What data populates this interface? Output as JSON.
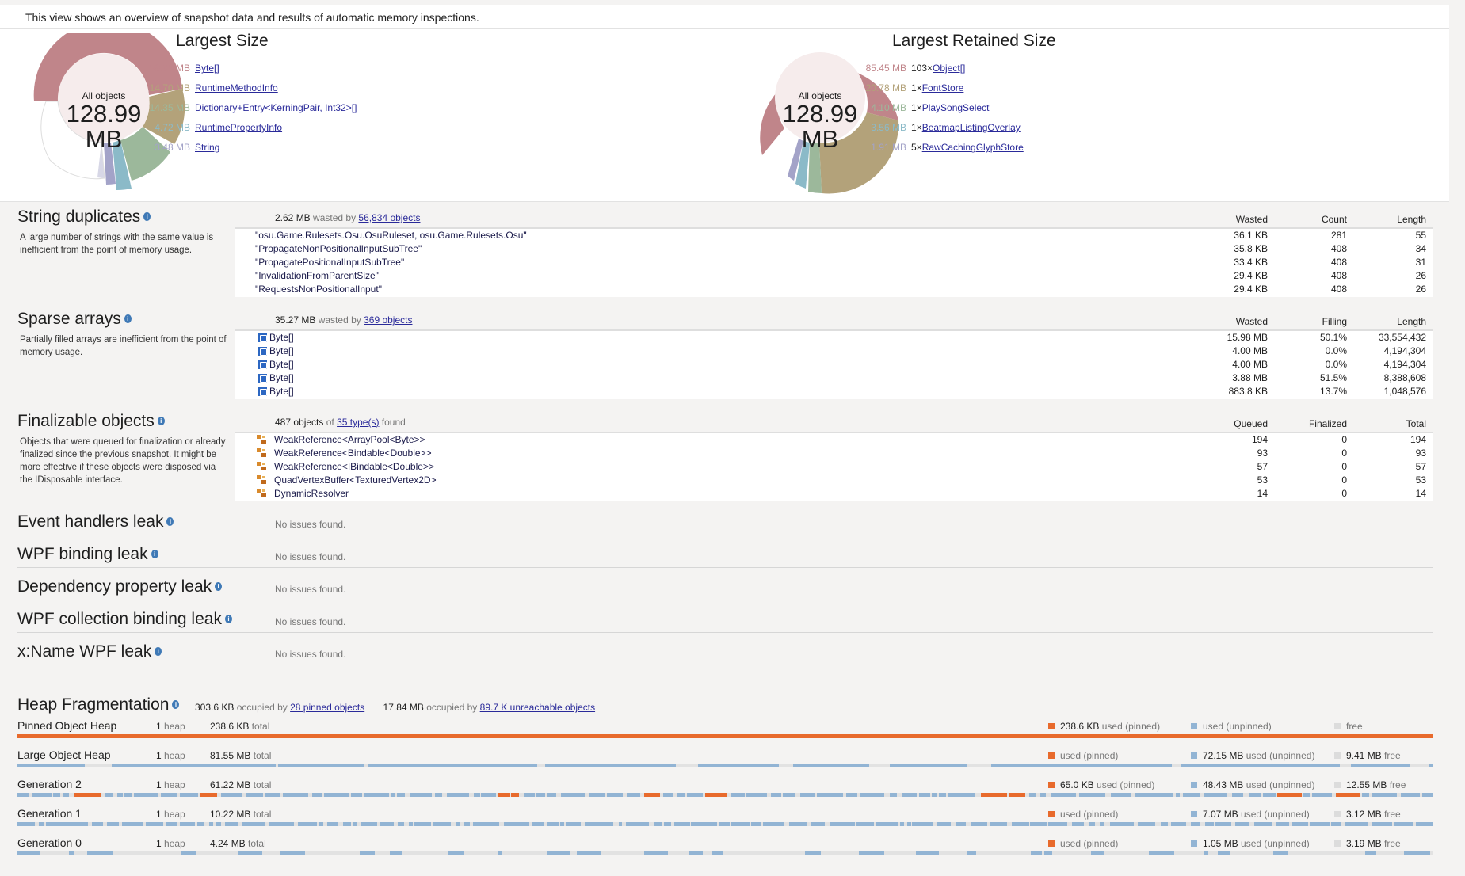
{
  "intro": "This view shows an overview of snapshot data and results of automatic memory inspections.",
  "largest_size": {
    "title": "Largest Size",
    "pie_label": "All objects",
    "pie_total": "128.99 MB",
    "items": [
      {
        "value": "58.69 MB",
        "prefix": "",
        "name": "Byte[]",
        "color": "#c0858a"
      },
      {
        "value": "14.70 MB",
        "prefix": "",
        "name": "RuntimeMethodInfo",
        "color": "#b3a27a"
      },
      {
        "value": "14.35 MB",
        "prefix": "",
        "name": "Dictionary+Entry<KerningPair, Int32>[]",
        "color": "#9cb89b"
      },
      {
        "value": "4.72 MB",
        "prefix": "",
        "name": "RuntimePropertyInfo",
        "color": "#8bbac8"
      },
      {
        "value": "3.48 MB",
        "prefix": "",
        "name": "String",
        "color": "#a3a3c8"
      }
    ]
  },
  "largest_retained": {
    "title": "Largest Retained Size",
    "pie_label": "All objects",
    "pie_total": "128.99 MB",
    "items": [
      {
        "value": "85.45 MB",
        "prefix": "103×",
        "name": "Object[]",
        "color": "#c0858a"
      },
      {
        "value": "20.78 MB",
        "prefix": "1×",
        "name": "FontStore",
        "color": "#b3a27a"
      },
      {
        "value": "4.10 MB",
        "prefix": "1×",
        "name": "PlaySongSelect",
        "color": "#9cb89b"
      },
      {
        "value": "3.56 MB",
        "prefix": "1×",
        "name": "BeatmapListingOverlay",
        "color": "#8bbac8"
      },
      {
        "value": "1.91 MB",
        "prefix": "5×",
        "name": "RawCachingGlyphStore",
        "color": "#a3a3c8"
      }
    ]
  },
  "string_duplicates": {
    "title": "String duplicates",
    "description": "A large number of strings with the same value is inefficient from the point of memory usage.",
    "summary_value": "2.62 MB",
    "summary_mid": "wasted by",
    "summary_link": "56,834 objects",
    "columns": [
      "Wasted",
      "Count",
      "Length"
    ],
    "rows": [
      {
        "name": "\"osu.Game.Rulesets.Osu.OsuRuleset, osu.Game.Rulesets.Osu\"",
        "a": "36.1 KB",
        "b": "281",
        "c": "55"
      },
      {
        "name": "\"PropagateNonPositionalInputSubTree\"",
        "a": "35.8 KB",
        "b": "408",
        "c": "34"
      },
      {
        "name": "\"PropagatePositionalInputSubTree\"",
        "a": "33.4 KB",
        "b": "408",
        "c": "31"
      },
      {
        "name": "\"InvalidationFromParentSize\"",
        "a": "29.4 KB",
        "b": "408",
        "c": "26"
      },
      {
        "name": "\"RequestsNonPositionalInput\"",
        "a": "29.4 KB",
        "b": "408",
        "c": "26"
      }
    ]
  },
  "sparse_arrays": {
    "title": "Sparse arrays",
    "description": "Partially filled arrays are inefficient from the point of memory usage.",
    "summary_value": "35.27 MB",
    "summary_mid": "wasted by",
    "summary_link": "369 objects",
    "columns": [
      "Wasted",
      "Filling",
      "Length"
    ],
    "rows": [
      {
        "name": "Byte[]",
        "a": "15.98 MB",
        "b": "50.1%",
        "c": "33,554,432"
      },
      {
        "name": "Byte[]",
        "a": "4.00 MB",
        "b": "0.0%",
        "c": "4,194,304"
      },
      {
        "name": "Byte[]",
        "a": "4.00 MB",
        "b": "0.0%",
        "c": "4,194,304"
      },
      {
        "name": "Byte[]",
        "a": "3.88 MB",
        "b": "51.5%",
        "c": "8,388,608"
      },
      {
        "name": "Byte[]",
        "a": "883.8 KB",
        "b": "13.7%",
        "c": "1,048,576"
      }
    ]
  },
  "finalizable": {
    "title": "Finalizable objects",
    "description": "Objects that were queued for finalization or already finalized since the previous snapshot. It might be more effective if these objects were disposed via the IDisposable interface.",
    "summary_value": "487 objects",
    "summary_mid": "of",
    "summary_link": "35 type(s)",
    "summary_end": "found",
    "columns": [
      "Queued",
      "Finalized",
      "Total"
    ],
    "rows": [
      {
        "name": "WeakReference<ArrayPool<Byte>>",
        "a": "194",
        "b": "0",
        "c": "194"
      },
      {
        "name": "WeakReference<Bindable<Double>>",
        "a": "93",
        "b": "0",
        "c": "93"
      },
      {
        "name": "WeakReference<IBindable<Double>>",
        "a": "57",
        "b": "0",
        "c": "57"
      },
      {
        "name": "QuadVertexBuffer<TexturedVertex2D>",
        "a": "53",
        "b": "0",
        "c": "53"
      },
      {
        "name": "DynamicResolver",
        "a": "14",
        "b": "0",
        "c": "14"
      }
    ]
  },
  "leaks": [
    {
      "title": "Event handlers leak",
      "status": "No issues found."
    },
    {
      "title": "WPF binding leak",
      "status": "No issues found."
    },
    {
      "title": "Dependency property leak",
      "status": "No issues found."
    },
    {
      "title": "WPF collection binding leak",
      "status": "No issues found."
    },
    {
      "title": "x:Name WPF leak",
      "status": "No issues found."
    }
  ],
  "heap": {
    "title": "Heap Fragmentation",
    "pinned_value": "303.6 KB",
    "pinned_mid": "occupied by",
    "pinned_link": "28 pinned objects",
    "unreach_value": "17.84 MB",
    "unreach_mid": "occupied by",
    "unreach_link": "89.7 K unreachable objects",
    "legend_pinned": "used (pinned)",
    "legend_unpinned": "used (unpinned)",
    "legend_free": "free",
    "heap_word": "heap",
    "total_word": "total",
    "rows": [
      {
        "name": "Pinned Object Heap",
        "count": "1",
        "total": "238.6 KB",
        "pinned": "238.6 KB",
        "unpinned": "",
        "free": ""
      },
      {
        "name": "Large Object Heap",
        "count": "1",
        "total": "81.55 MB",
        "pinned": "",
        "unpinned": "72.15 MB",
        "free": "9.41 MB"
      },
      {
        "name": "Generation 2",
        "count": "1",
        "total": "61.22 MB",
        "pinned": "65.0 KB",
        "unpinned": "48.43 MB",
        "free": "12.55 MB"
      },
      {
        "name": "Generation 1",
        "count": "1",
        "total": "10.22 MB",
        "pinned": "",
        "unpinned": "7.07 MB",
        "free": "3.12 MB"
      },
      {
        "name": "Generation 0",
        "count": "1",
        "total": "4.24 MB",
        "pinned": "",
        "unpinned": "1.05 MB",
        "free": "3.19 MB"
      }
    ],
    "colors": {
      "pinned": "#e86a2c",
      "unpinned": "#92b4d4",
      "free": "#dcdcdc"
    }
  }
}
